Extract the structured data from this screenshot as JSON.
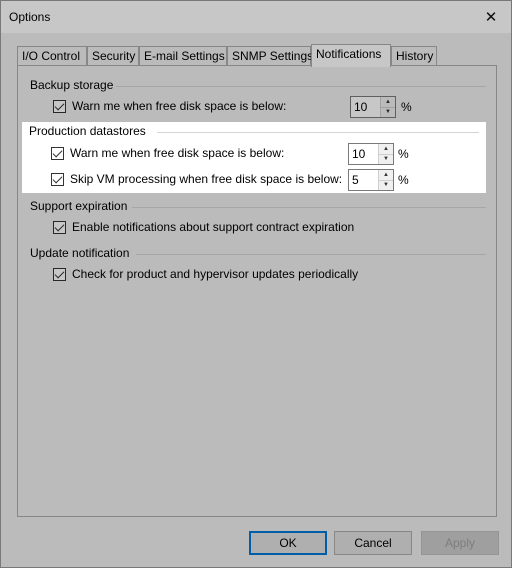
{
  "window": {
    "title": "Options"
  },
  "tabs": [
    {
      "label": "I/O Control"
    },
    {
      "label": "Security"
    },
    {
      "label": "E-mail Settings"
    },
    {
      "label": "SNMP Settings"
    },
    {
      "label": "Notifications"
    },
    {
      "label": "History"
    }
  ],
  "active_tab": "Notifications",
  "backup_storage": {
    "title": "Backup storage",
    "warn_label": "Warn me when free disk space is below:",
    "warn_checked": true,
    "warn_value": "10",
    "unit": "%"
  },
  "production_datastores": {
    "title": "Production datastores",
    "warn_label": "Warn me when free disk space is below:",
    "warn_checked": true,
    "warn_value": "10",
    "warn_unit": "%",
    "skip_label": "Skip VM processing when free disk space is below:",
    "skip_checked": true,
    "skip_value": "5",
    "skip_unit": "%"
  },
  "support_expiration": {
    "title": "Support expiration",
    "label": "Enable notifications about support contract expiration",
    "checked": true
  },
  "update_notification": {
    "title": "Update notification",
    "label": "Check for product and hypervisor updates periodically",
    "checked": true
  },
  "buttons": {
    "ok": "OK",
    "cancel": "Cancel",
    "apply": "Apply"
  }
}
